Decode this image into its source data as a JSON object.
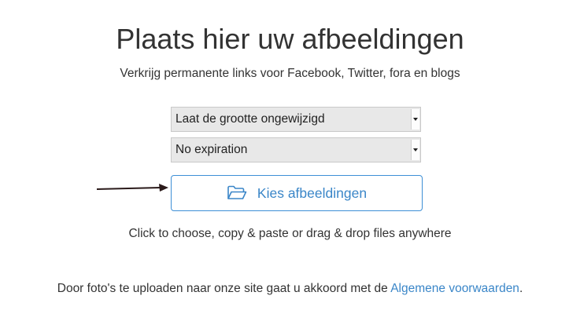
{
  "header": {
    "title": "Plaats hier uw afbeeldingen",
    "subtitle": "Verkrijg permanente links voor Facebook, Twitter, fora en blogs"
  },
  "upload": {
    "resize_select": {
      "selected": "Laat de grootte ongewijzigd"
    },
    "expiration_select": {
      "selected": "No expiration"
    },
    "choose_button": {
      "label": "Kies afbeeldingen",
      "icon": "folder-open-icon"
    },
    "hint": "Click to choose, copy & paste or drag & drop files anywhere"
  },
  "footer": {
    "terms_text": "Door foto's te uploaden naar onze site gaat u akkoord met de ",
    "terms_link": "Algemene voorwaarden",
    "terms_end": "."
  },
  "colors": {
    "accent": "#3a86c8",
    "button_border": "#3d8fd6",
    "select_bg": "#e8e8e8",
    "text": "#333333",
    "arrow": "#2a1a1a"
  }
}
